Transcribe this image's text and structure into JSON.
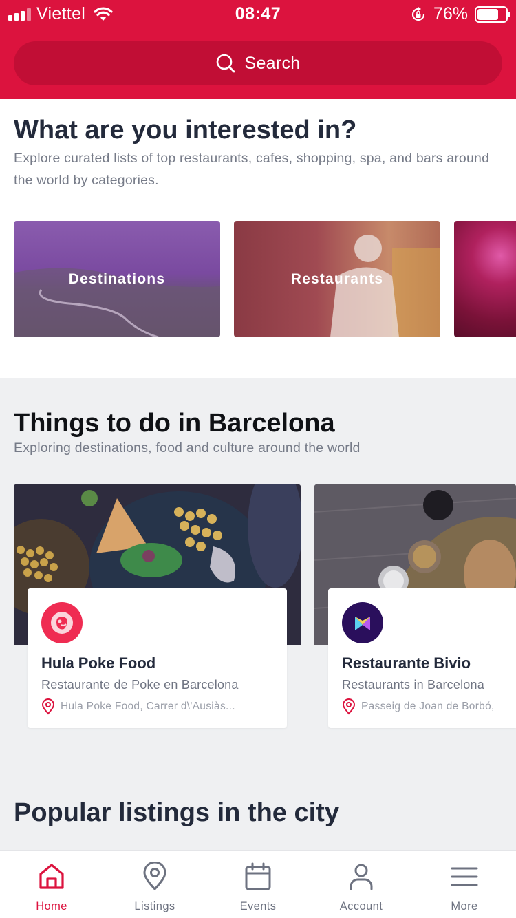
{
  "status_bar": {
    "carrier": "Viettel",
    "time": "08:47",
    "battery": "76%",
    "battery_level": 0.76
  },
  "search": {
    "label": "Search"
  },
  "interests": {
    "title": "What are you interested in?",
    "subtitle": "Explore curated lists of top restaurants, cafes, shopping, spa, and bars around the world by categories.",
    "categories": [
      {
        "label": "Destinations"
      },
      {
        "label": "Restaurants"
      },
      {
        "label": ""
      }
    ]
  },
  "things_to_do": {
    "title": "Things to do in Barcelona",
    "subtitle": "Exploring destinations, food and culture around the world",
    "places": [
      {
        "name": "Hula Poke Food",
        "category": "Restaurante de Poke en Barcelona",
        "address": "Hula Poke Food, Carrer d\\'Ausiàs...",
        "logo_color": "#ef2c52"
      },
      {
        "name": "Restaurante Bivio",
        "category": "Restaurants in Barcelona",
        "address": "Passeig de Joan de Borbó,",
        "logo_color": "#2a0f5c"
      }
    ]
  },
  "popular": {
    "title": "Popular listings in the city"
  },
  "tabbar": {
    "items": [
      {
        "label": "Home",
        "icon": "home-icon",
        "active": true
      },
      {
        "label": "Listings",
        "icon": "map-pin-icon",
        "active": false
      },
      {
        "label": "Events",
        "icon": "calendar-icon",
        "active": false
      },
      {
        "label": "Account",
        "icon": "user-icon",
        "active": false
      },
      {
        "label": "More",
        "icon": "menu-icon",
        "active": false
      }
    ]
  },
  "colors": {
    "brand": "#dc133e",
    "brand_dark": "#c10e35",
    "section_bg": "#eff0f2",
    "text_dark": "#232a3b",
    "text_muted": "#767b88"
  }
}
